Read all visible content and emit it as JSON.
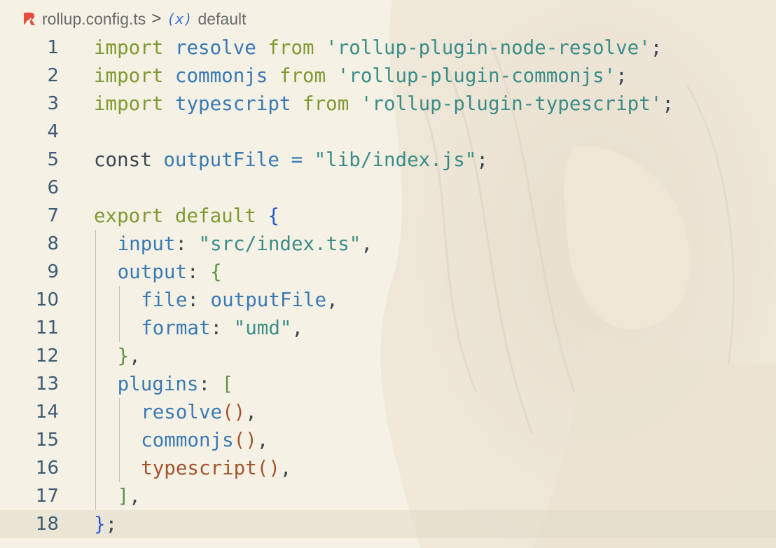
{
  "breadcrumb": {
    "file": "rollup.config.ts",
    "separator": ">",
    "symbol_icon": "(x)",
    "symbol": "default"
  },
  "icons": {
    "file_icon": "rollup-icon",
    "symbol_icon": "variable-icon"
  },
  "colors": {
    "background": "#f6f1e5",
    "keyword": "#7f9a31",
    "identifier": "#3a7ab4",
    "string": "#3a8d88",
    "bracket_level1": "#2a59d6",
    "bracket_level2": "#5b9446",
    "bracket_level3": "#a3542e"
  },
  "editor": {
    "current_line": 18,
    "lines": [
      {
        "n": "1",
        "t": {
          "k": "import",
          "i": "resolve",
          "f": "from",
          "s": "'rollup-plugin-node-resolve'",
          "e": ";"
        }
      },
      {
        "n": "2",
        "t": {
          "k": "import",
          "i": "commonjs",
          "f": "from",
          "s": "'rollup-plugin-commonjs'",
          "e": ";"
        }
      },
      {
        "n": "3",
        "t": {
          "k": "import",
          "i": "typescript",
          "f": "from",
          "s": "'rollup-plugin-typescript'",
          "e": ";"
        }
      },
      {
        "n": "4"
      },
      {
        "n": "5",
        "t": {
          "k": "const",
          "i": "outputFile",
          "o": "=",
          "s": "\"lib/index.js\"",
          "e": ";"
        }
      },
      {
        "n": "6"
      },
      {
        "n": "7",
        "t": {
          "k": "export default",
          "b": "{"
        }
      },
      {
        "n": "8",
        "t": {
          "p": "input",
          "c": ":",
          "s": "\"src/index.ts\"",
          "e": ","
        }
      },
      {
        "n": "9",
        "t": {
          "p": "output",
          "c": ":",
          "b": "{"
        }
      },
      {
        "n": "10",
        "t": {
          "p": "file",
          "c": ":",
          "v": "outputFile",
          "e": ","
        }
      },
      {
        "n": "11",
        "t": {
          "p": "format",
          "c": ":",
          "s": "\"umd\"",
          "e": ","
        }
      },
      {
        "n": "12",
        "t": {
          "b": "}",
          "e": ","
        }
      },
      {
        "n": "13",
        "t": {
          "p": "plugins",
          "c": ":",
          "b": "["
        }
      },
      {
        "n": "14",
        "t": {
          "fn": "resolve",
          "par": "()",
          "e": ","
        }
      },
      {
        "n": "15",
        "t": {
          "fn": "commonjs",
          "par": "()",
          "e": ","
        }
      },
      {
        "n": "16",
        "t": {
          "fn": "typescript",
          "par": "()",
          "e": ","
        }
      },
      {
        "n": "17",
        "t": {
          "b": "]",
          "e": ","
        }
      },
      {
        "n": "18",
        "t": {
          "b": "}",
          "e": ";"
        }
      }
    ]
  }
}
